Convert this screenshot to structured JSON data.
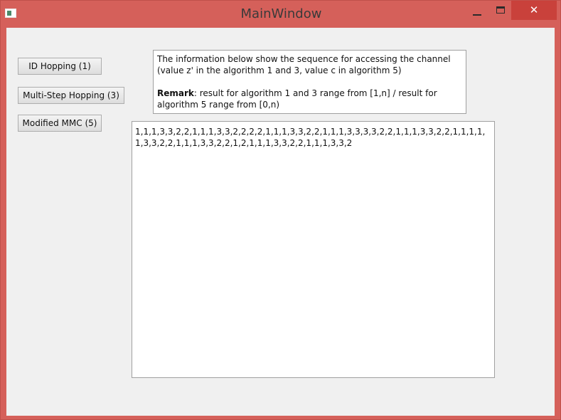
{
  "window": {
    "title": "MainWindow",
    "close_label": "✕"
  },
  "buttons": {
    "id_hopping": "ID Hopping (1)",
    "multi_step_hopping": "Multi-Step Hopping (3)",
    "modified_mmc": "Modified MMC (5)"
  },
  "info": {
    "line1": "The information below show the sequence for accessing the channel",
    "line2": "(value z' in the algorithm 1 and 3, value c in algorithm 5)",
    "remark_label": "Remark",
    "remark_text": ": result for algorithm 1 and 3 range from [1,n] / result for",
    "remark_text2": "algorithm 5 range from [0,n)"
  },
  "result": {
    "text": "1,1,1,3,3,2,2,1,1,1,3,3,2,2,2,2,1,1,1,3,3,2,2,1,1,1,3,3,3,3,2,2,1,1,1,3,3,2,2,1,1,1,1,1,3,3,2,2,1,1,1,3,3,2,2,1,2,1,1,1,3,3,2,2,1,1,1,3,3,2"
  },
  "colors": {
    "titlebar": "#d5605a",
    "close_button": "#c9413b",
    "client_background": "#f0f0f0"
  }
}
